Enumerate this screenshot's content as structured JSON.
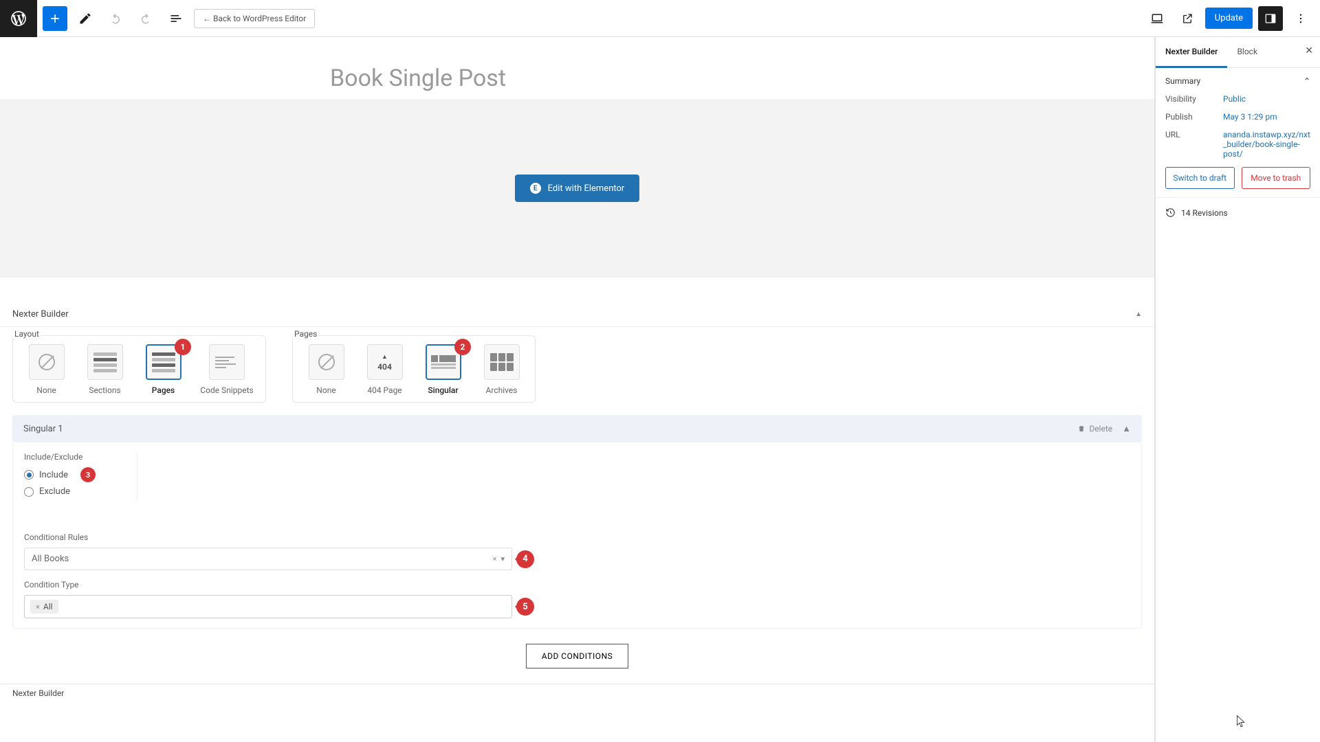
{
  "topbar": {
    "back_label": "← Back to WordPress Editor",
    "update_label": "Update"
  },
  "page": {
    "title": "Book Single Post",
    "elementor_btn": "Edit with Elementor"
  },
  "nb": {
    "panel_title": "Nexter Builder",
    "layout_label": "Layout",
    "pages_label": "Pages",
    "layout_options": {
      "none": "None",
      "sections": "Sections",
      "pages": "Pages",
      "code": "Code Snippets"
    },
    "pages_options": {
      "none": "None",
      "p404": "404 Page",
      "singular": "Singular",
      "archives": "Archives"
    },
    "layout_selected": "pages",
    "pages_selected": "singular",
    "badges": {
      "layout": "1",
      "pages": "2",
      "include": "3",
      "rules": "4",
      "ctype": "5"
    }
  },
  "condition": {
    "header": "Singular 1",
    "delete": "Delete",
    "include_exclude_label": "Include/Exclude",
    "include": "Include",
    "exclude": "Exclude",
    "rules_label": "Conditional Rules",
    "rules_value": "All Books",
    "ctype_label": "Condition Type",
    "ctype_tag": "All",
    "add_btn": "ADD CONDITIONS"
  },
  "footer": {
    "crumb": "Nexter Builder"
  },
  "sidebar": {
    "tabs": {
      "nexter": "Nexter Builder",
      "block": "Block"
    },
    "summary": "Summary",
    "visibility_k": "Visibility",
    "visibility_v": "Public",
    "publish_k": "Publish",
    "publish_v": "May 3 1:29 pm",
    "url_k": "URL",
    "url_v": "ananda.instawp.xyz/nxt_builder/book-single-post/",
    "draft_btn": "Switch to draft",
    "trash_btn": "Move to trash",
    "revisions": "14 Revisions"
  }
}
